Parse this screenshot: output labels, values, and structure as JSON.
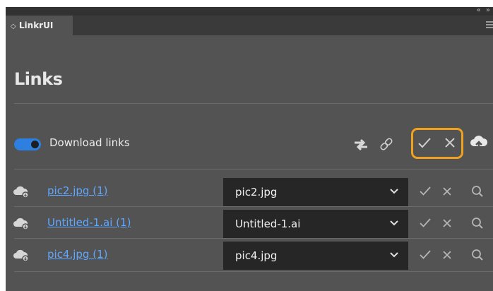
{
  "panel": {
    "tab_label": "LinkrUI",
    "tab_arrows": "◇",
    "collapse_glyph": "«  »",
    "title": "Links"
  },
  "toolbar": {
    "toggle_on": true,
    "download_label": "Download links",
    "icons": [
      "swap-icon",
      "link-icon",
      "check-icon",
      "close-icon",
      "cloud-upload-icon"
    ],
    "highlight_color": "#f0a21e"
  },
  "links": [
    {
      "name": "pic2.jpg (1)",
      "selected": "pic2.jpg"
    },
    {
      "name": "Untitled-1.ai (1)",
      "selected": "Untitled-1.ai"
    },
    {
      "name": "pic4.jpg (1)",
      "selected": "pic4.jpg"
    }
  ],
  "colors": {
    "panel_bg": "#535353",
    "link": "#5fa7ff",
    "toggle": "#2d80e0",
    "dropdown_bg": "#262626"
  }
}
